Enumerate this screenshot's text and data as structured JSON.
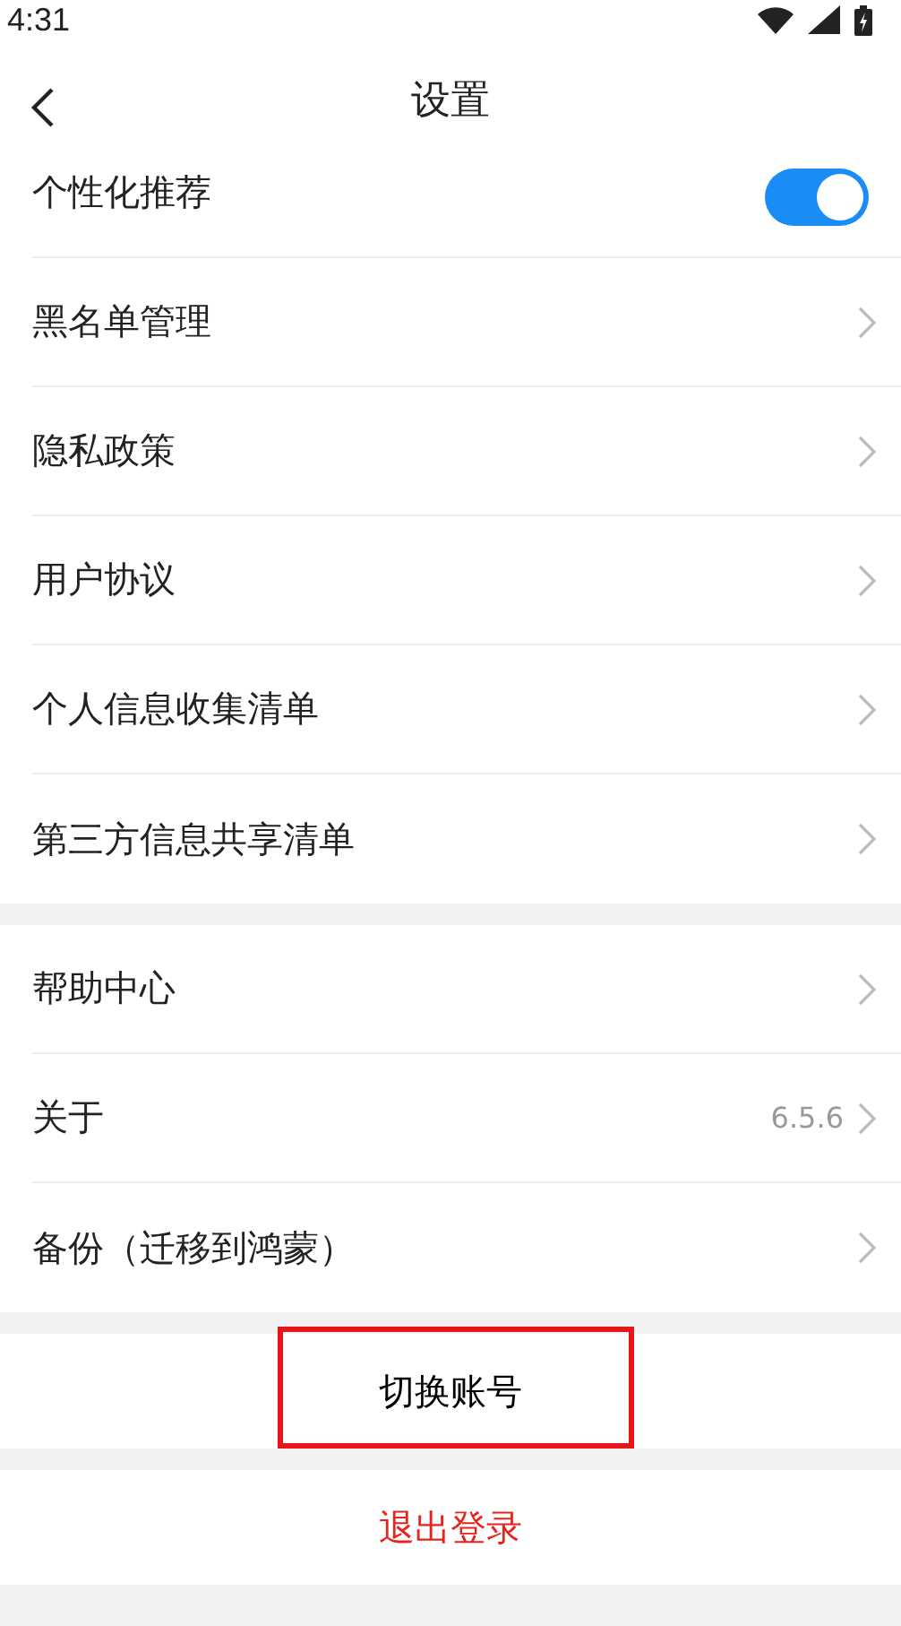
{
  "status_bar": {
    "time": "4:31"
  },
  "header": {
    "title": "设置"
  },
  "groups": [
    {
      "items": [
        {
          "kind": "toggle",
          "label": "个性化推荐",
          "on": true
        },
        {
          "kind": "link",
          "label": "黑名单管理"
        },
        {
          "kind": "link",
          "label": "隐私政策"
        },
        {
          "kind": "link",
          "label": "用户协议"
        },
        {
          "kind": "link",
          "label": "个人信息收集清单"
        },
        {
          "kind": "link",
          "label": "第三方信息共享清单"
        }
      ]
    },
    {
      "items": [
        {
          "kind": "link",
          "label": "帮助中心"
        },
        {
          "kind": "link",
          "label": "关于",
          "value": "6.5.6"
        },
        {
          "kind": "link",
          "label": "备份（迁移到鸿蒙）"
        }
      ]
    }
  ],
  "actions": [
    {
      "kind": "normal",
      "label": "切换账号",
      "highlighted": true
    },
    {
      "kind": "danger",
      "label": "退出登录",
      "highlighted": false
    }
  ]
}
